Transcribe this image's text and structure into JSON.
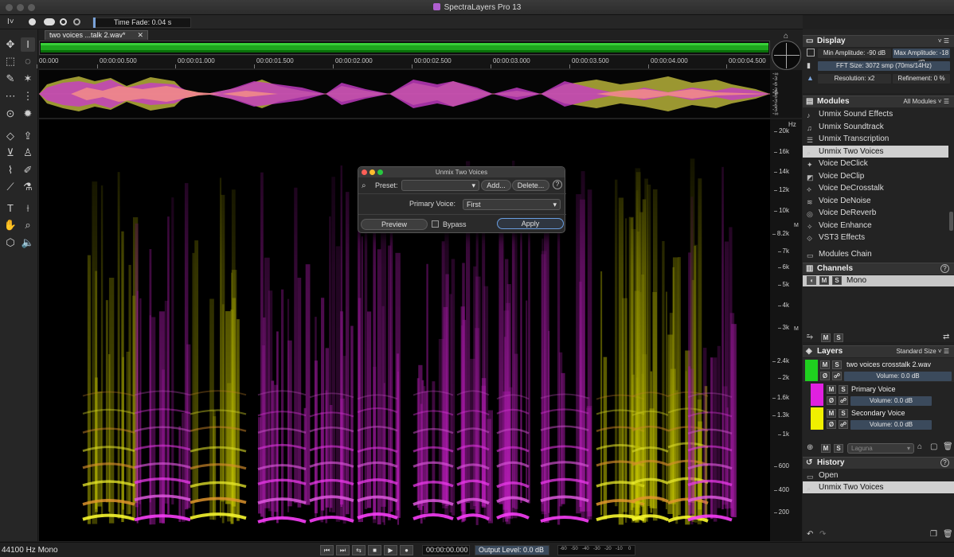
{
  "app": {
    "title": "SpectraLayers Pro 13"
  },
  "options": {
    "time_fade": "Time Fade: 0.04 s"
  },
  "file_tab": {
    "label": "two voices ...talk 2.wav*",
    "close": "✕"
  },
  "timeline": {
    "ticks": [
      "00.000",
      "00:00:00.500",
      "00:00:01.000",
      "00:00:01.500",
      "00:00:02.000",
      "00:00:02.500",
      "00:00:03.000",
      "00:00:03.500",
      "00:00:04.000",
      "00:00:04.500"
    ]
  },
  "wave_scale": [
    "-∞",
    "-3",
    "-6",
    "-3",
    "-6",
    "-∞",
    "-6",
    "-3",
    "-6",
    "-3",
    "-∞"
  ],
  "freq_scale": {
    "unit": "Hz",
    "labels": [
      "20k",
      "16k",
      "14k",
      "12k",
      "10k",
      "8.2k",
      "7k",
      "6k",
      "5k",
      "4k",
      "3k",
      "2.4k",
      "2k",
      "1.6k",
      "1.3k",
      "1k",
      "600",
      "400",
      "200"
    ],
    "m_marks": [
      "M",
      "M"
    ]
  },
  "dialog": {
    "title": "Unmix Two Voices",
    "preset_label": "Preset:",
    "preset_value": "",
    "add": "Add...",
    "delete": "Delete...",
    "help": "?",
    "primary_label": "Primary Voice:",
    "primary_value": "First",
    "preview": "Preview",
    "bypass": "Bypass",
    "apply": "Apply"
  },
  "display": {
    "title": "Display",
    "min_amp": "Min Amplitude: -90 dB",
    "max_amp": "Max Amplitude: -18 dB",
    "fft": "FFT Size: 3072 smp (70ms/14Hz)",
    "resolution": "Resolution: x2",
    "refinement": "Refinement: 0 %"
  },
  "modules": {
    "title": "Modules",
    "filter": "All Modules",
    "items": [
      "Unmix Sound Effects",
      "Unmix Soundtrack",
      "Unmix Transcription",
      "Unmix Two Voices",
      "Voice DeClick",
      "Voice DeClip",
      "Voice DeCrosstalk",
      "Voice DeNoise",
      "Voice DeReverb",
      "Voice Enhance",
      "VST3 Effects"
    ],
    "active_index": 3,
    "chain": "Modules Chain"
  },
  "channels": {
    "title": "Channels",
    "help": "?",
    "mono": "Mono"
  },
  "layers": {
    "title": "Layers",
    "size": "Standard Size",
    "items": [
      {
        "name": "two voices crosstalk 2.wav",
        "volume": "Volume: 0.0 dB",
        "color": "#1fd01f"
      },
      {
        "name": "Primary Voice",
        "volume": "Volume: 0.0 dB",
        "color": "#e020e0"
      },
      {
        "name": "Secondary Voice",
        "volume": "Volume: 0.0 dB",
        "color": "#f0f000"
      }
    ],
    "blend": "Laguna"
  },
  "history": {
    "title": "History",
    "help": "?",
    "items": [
      "Open",
      "Unmix Two Voices"
    ],
    "active_index": 1
  },
  "status": {
    "format": "44100 Hz Mono",
    "time": "00:00:00.000",
    "output": "Output Level: 0.0 dB",
    "meter_ticks": [
      "-60",
      "-50",
      "-40",
      "-30",
      "-20",
      "-10",
      "0"
    ]
  }
}
